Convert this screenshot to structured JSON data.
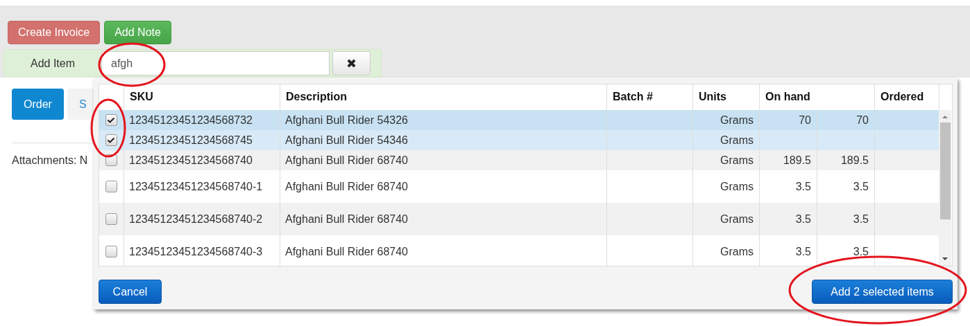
{
  "toolbar": {
    "buttons": [
      {
        "label": "Create Invoice",
        "kind": "danger"
      },
      {
        "label": "Add Note",
        "kind": "success"
      }
    ]
  },
  "add_item": {
    "label": "Add Item",
    "value": "afgh",
    "clear": "✖"
  },
  "tabs": [
    {
      "label": "Order",
      "selected": true
    },
    {
      "label": "S",
      "selected": false
    }
  ],
  "attachments": "Attachments: N",
  "dialog": {
    "columns": [
      "SKU",
      "Description",
      "Batch #",
      "Units",
      "On hand",
      "Ordered"
    ],
    "rows": [
      {
        "checked": true,
        "hovered": true,
        "sku": "12345123451234568732",
        "description": "Afghani Bull Rider 54326",
        "units": "Grams",
        "on_hand": "70",
        "on_hand_2": "70"
      },
      {
        "checked": true,
        "hovered": false,
        "sku": "12345123451234568745",
        "description": "Afghani Bull Rider 54346",
        "units": "Grams"
      },
      {
        "checked": false,
        "hovered": false,
        "sku": "12345123451234568740",
        "description": "Afghani Bull Rider 68740",
        "units": "Grams",
        "on_hand": "189.5",
        "on_hand_2": "189.5"
      },
      {
        "checked": false,
        "hovered": false,
        "sku": "12345123451234568740-1",
        "description": "Afghani Bull Rider 68740",
        "units": "Grams",
        "on_hand": "3.5",
        "on_hand_2": "3.5"
      },
      {
        "checked": false,
        "hovered": false,
        "sku": "12345123451234568740-2",
        "description": "Afghani Bull Rider 68740",
        "units": "Grams",
        "on_hand": "3.5",
        "on_hand_2": "3.5"
      },
      {
        "checked": false,
        "hovered": false,
        "sku": "12345123451234568740-3",
        "description": "Afghani Bull Rider 68740",
        "units": "Grams",
        "on_hand": "3.5",
        "on_hand_2": "3.5"
      }
    ],
    "cancel": "Cancel",
    "submit": "Add 2 selected items"
  }
}
